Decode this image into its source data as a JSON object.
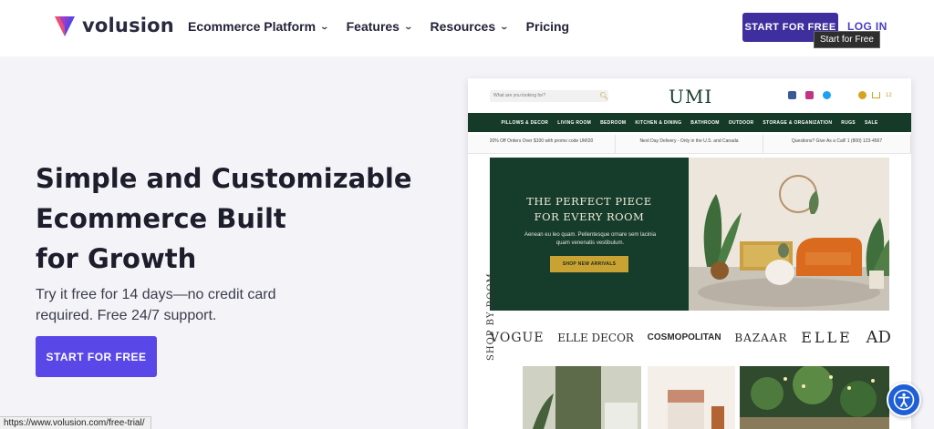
{
  "header": {
    "logo_text": "volusion",
    "nav": [
      {
        "label": "Ecommerce Platform",
        "has_dropdown": true
      },
      {
        "label": "Features",
        "has_dropdown": true
      },
      {
        "label": "Resources",
        "has_dropdown": true
      },
      {
        "label": "Pricing",
        "has_dropdown": false
      }
    ],
    "cta_label": "START FOR FREE",
    "login_label": "LOG IN",
    "tooltip": "Start for Free"
  },
  "hero": {
    "headline_lines": [
      "Simple and Customizable",
      "Ecommerce Built",
      "for Growth"
    ],
    "subtext_lines": [
      "Try it free for 14 days—no credit card",
      "required. Free 24/7 support."
    ],
    "cta_label": "START FOR FREE"
  },
  "preview": {
    "search_placeholder": "What are you looking for?",
    "store_logo": "UMI",
    "cart_count": "12",
    "menu": [
      "PILLOWS & DECOR",
      "LIVING ROOM",
      "BEDROOM",
      "KITCHEN & DINING",
      "BATHROOM",
      "OUTDOOR",
      "STORAGE & ORGANIZATION",
      "RUGS",
      "SALE"
    ],
    "promo_strip": [
      "20% Off Orders Over $100 with promo code UMI20",
      "Next Day Delivery - Only in the U.S. and Canada",
      "Questions? Give As a Call! 1 (800) 123-4567"
    ],
    "banner": {
      "title_lines": [
        "THE PERFECT PIECE",
        "FOR EVERY ROOM"
      ],
      "text": "Aenean eu leo quam. Pellentesque ornare sem lacinia quam venenatis vestibulum.",
      "button": "SHOP NEW ARRIVALS"
    },
    "brands": [
      "VOGUE",
      "ELLE DECOR",
      "COSMOPOLITAN",
      "BAZAAR",
      "ELLE",
      "AD"
    ],
    "shop_by_room": "SHOP BY ROOM"
  },
  "status_url": "https://www.volusion.com/free-trial/",
  "colors": {
    "primary_dark": "#3f2f9e",
    "primary": "#5a47e8",
    "login": "#4a3ec8",
    "umi_green": "#153b28",
    "umi_gold": "#c9a234",
    "accessibility": "#1f5fd6"
  },
  "icons": [
    "volusion-logo-icon",
    "chevron-down-icon",
    "search-icon",
    "facebook-icon",
    "instagram-icon",
    "twitter-icon",
    "account-icon",
    "cart-icon",
    "accessibility-icon"
  ]
}
